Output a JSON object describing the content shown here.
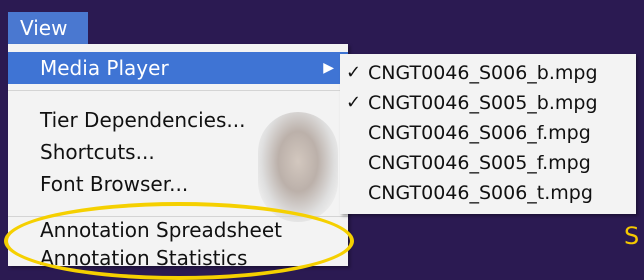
{
  "menubar": {
    "view_label": "View"
  },
  "menu": {
    "items": [
      {
        "label": "Media Player",
        "highlighted": true,
        "has_submenu": true
      },
      {
        "label": "Tier Dependencies..."
      },
      {
        "label": "Shortcuts..."
      },
      {
        "label": "Font Browser..."
      },
      {
        "label": "Annotation Spreadsheet"
      },
      {
        "label": "Annotation Statistics"
      }
    ]
  },
  "submenu": {
    "items": [
      {
        "label": "CNGT0046_S006_b.mpg",
        "checked": true
      },
      {
        "label": "CNGT0046_S005_b.mpg",
        "checked": true
      },
      {
        "label": "CNGT0046_S006_f.mpg",
        "checked": false
      },
      {
        "label": "CNGT0046_S005_f.mpg",
        "checked": false
      },
      {
        "label": "CNGT0046_S006_t.mpg",
        "checked": false
      }
    ]
  },
  "overlay": {
    "partial_text": "S"
  },
  "colors": {
    "background": "#2b1a52",
    "menu_highlight": "#3f74d4",
    "ring": "#f5d000"
  }
}
